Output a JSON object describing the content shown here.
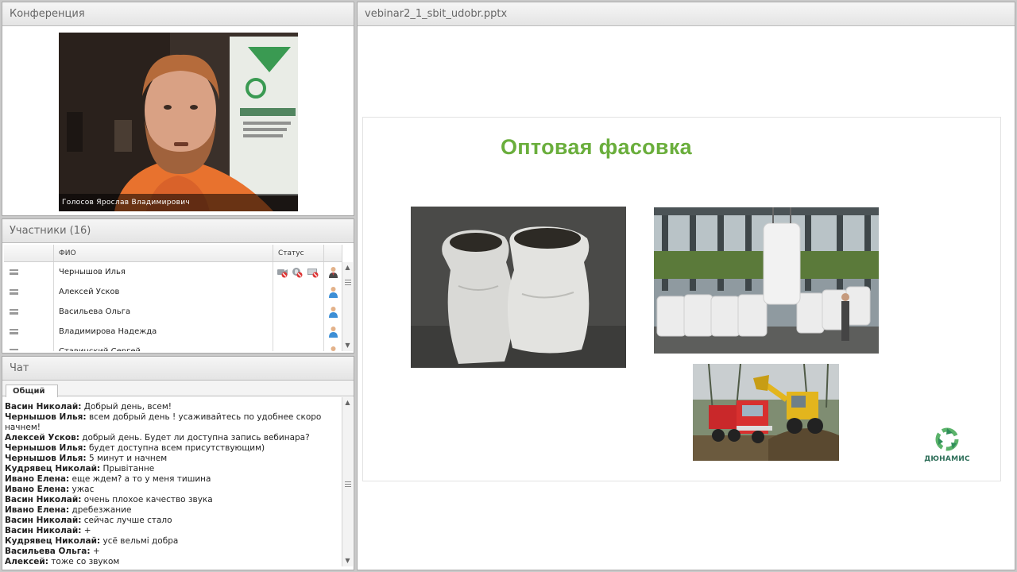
{
  "conference": {
    "title": "Конференция",
    "video_caption": "Голосов Ярослав  Владимирович"
  },
  "participants": {
    "title": "Участники (16)",
    "columns": {
      "name": "ФИО",
      "status": "Статус"
    },
    "rows": [
      {
        "name": "Чернышов Илья",
        "status_icons": [
          "camera-off-icon",
          "mic-off-icon",
          "screen-off-icon"
        ],
        "role_icon": "presenter-icon"
      },
      {
        "name": "Алексей Усков",
        "status_icons": [],
        "role_icon": "user-icon"
      },
      {
        "name": "Васильева  Ольга",
        "status_icons": [],
        "role_icon": "user-icon"
      },
      {
        "name": "Владимирова Надежда",
        "status_icons": [],
        "role_icon": "user-icon"
      },
      {
        "name": "Ставинский Сергей",
        "status_icons": [],
        "role_icon": "user-icon"
      }
    ]
  },
  "chat": {
    "title": "Чат",
    "tab": "Общий",
    "messages": [
      {
        "author": "Васин Николай:",
        "text": " Добрый день, всем!"
      },
      {
        "author": "Чернышов Илья:",
        "text": " всем добрый день ! усаживайтесь по удобнее скоро начнем!"
      },
      {
        "author": "Алексей Усков:",
        "text": " добрый день. Будет ли доступна запись вебинара?"
      },
      {
        "author": "Чернышов Илья:",
        "text": " будет  доступна всем присутствующим)"
      },
      {
        "author": "Чернышов Илья:",
        "text": " 5 минут и начнем"
      },
      {
        "author": "Кудрявец Николай:",
        "text": " Прывітанне"
      },
      {
        "author": "Ивано Елена:",
        "text": " еще  ждем? а то у меня тишина"
      },
      {
        "author": "Ивано Елена:",
        "text": " ужас"
      },
      {
        "author": "Васин Николай:",
        "text": " очень плохое качество звука"
      },
      {
        "author": "Ивано Елена:",
        "text": " дребезжание"
      },
      {
        "author": "Васин Николай:",
        "text": " сейчас лучше стало"
      },
      {
        "author": "Васин Николай:",
        "text": " +"
      },
      {
        "author": "Кудрявец Николай:",
        "text": " усё вельмі добра"
      },
      {
        "author": "Васильева  Ольга:",
        "text": " +"
      },
      {
        "author": "Алексей:",
        "text": " тоже со звуком"
      }
    ]
  },
  "presentation": {
    "filename": "vebinar2_1_sbit_udobr.pptx",
    "slide_title": "Оптовая фасовка",
    "logo_text": "ДЮНАМИС",
    "colors": {
      "title": "#6aae3c",
      "logo": "#2f6f5a"
    }
  }
}
